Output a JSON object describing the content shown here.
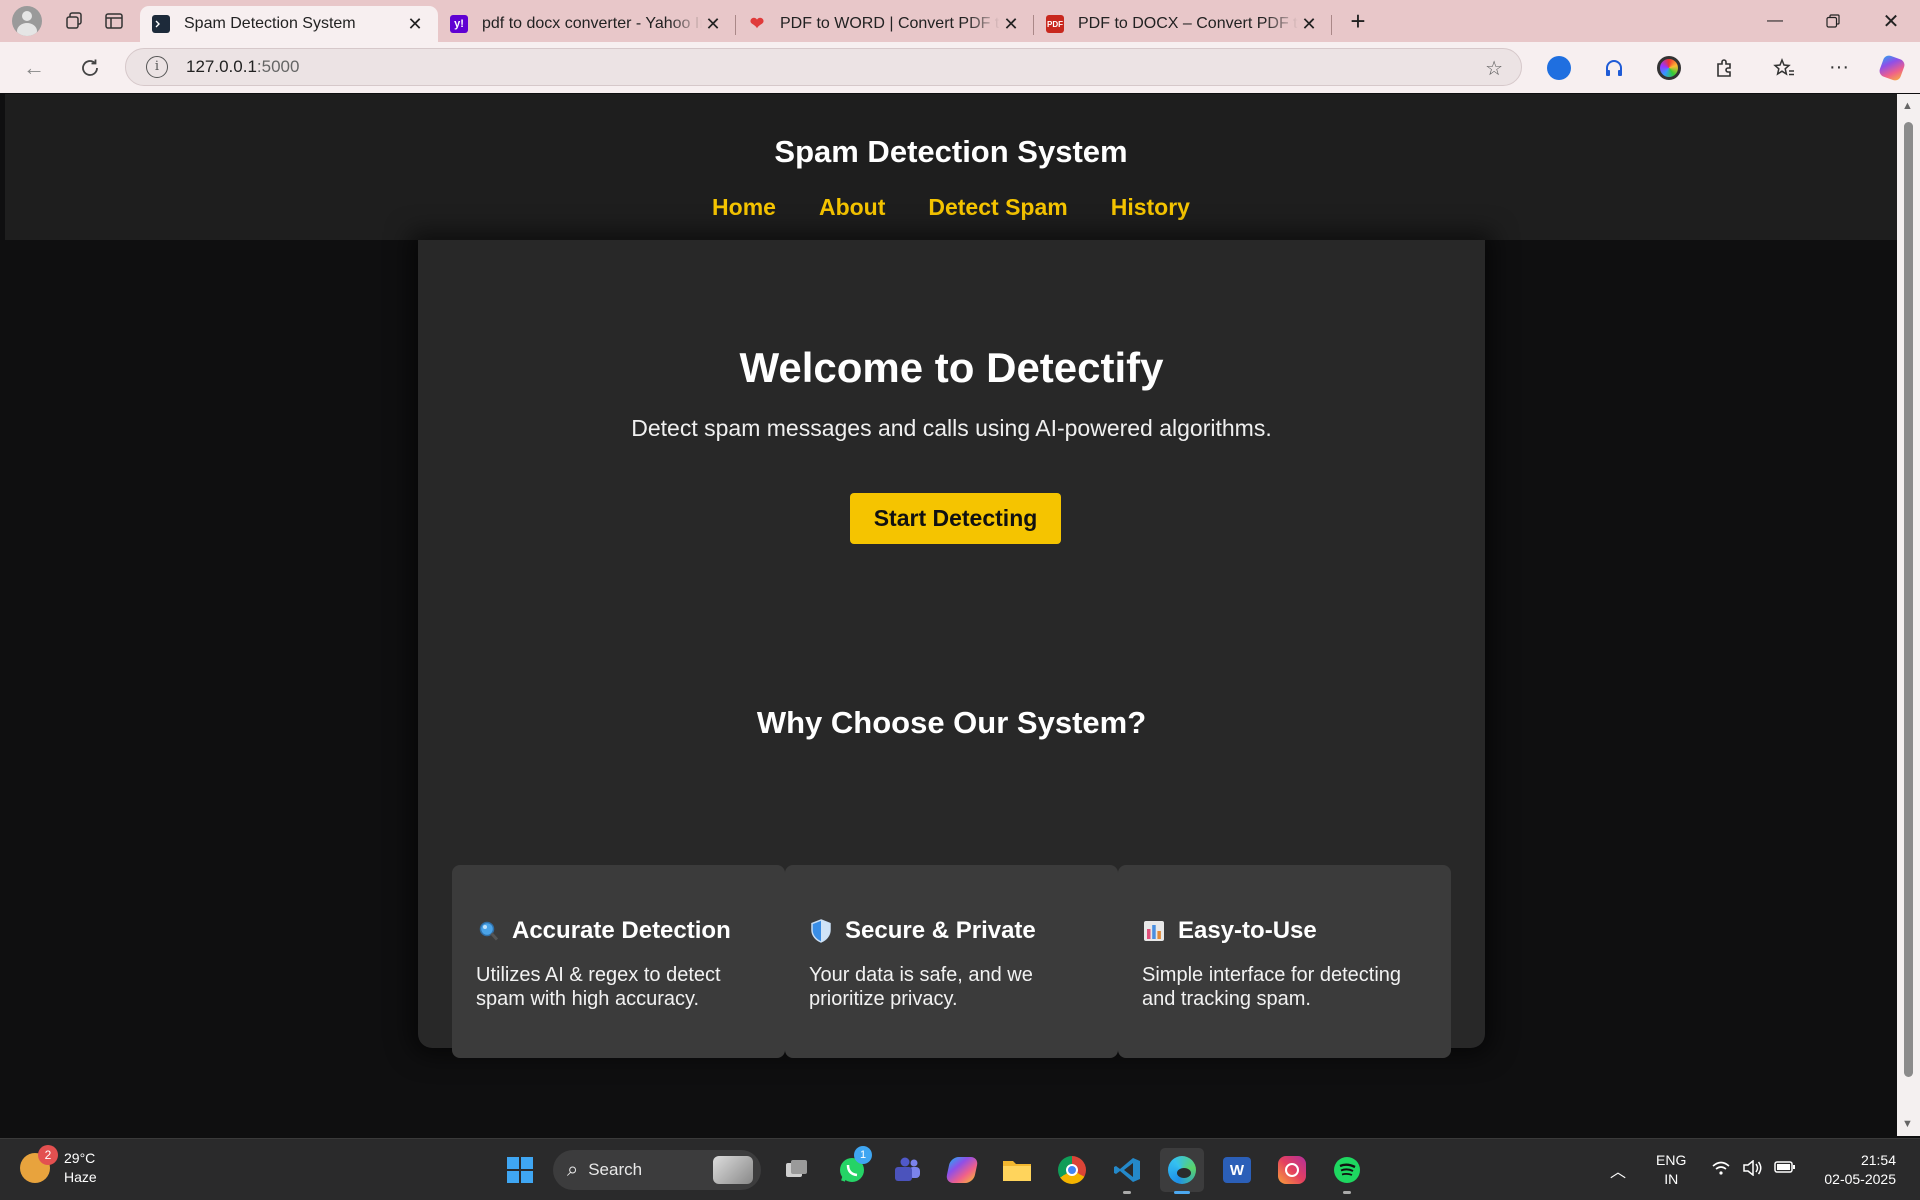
{
  "browser": {
    "tabs": [
      {
        "title": "Spam Detection System",
        "favicon": "terminal-icon",
        "active": true
      },
      {
        "title": "pdf to docx converter - Yahoo India",
        "favicon": "yahoo-icon",
        "active": false
      },
      {
        "title": "PDF to WORD | Convert PDF to Word",
        "favicon": "heart-icon",
        "active": false
      },
      {
        "title": "PDF to DOCX – Convert PDF to DOCX",
        "favicon": "pdf-icon",
        "active": false
      }
    ],
    "url_host": "127.0.0.1",
    "url_port": ":5000",
    "pdf_favicon_text": "PDF",
    "yahoo_favicon_text": "y!"
  },
  "site": {
    "title": "Spam Detection System",
    "nav": [
      "Home",
      "About",
      "Detect Spam",
      "History"
    ],
    "accent_color": "#f5c400"
  },
  "hero": {
    "title": "Welcome to Detectify",
    "subtitle": "Detect spam messages and calls using AI-powered algorithms.",
    "cta_label": "Start Detecting"
  },
  "features": {
    "title": "Why Choose Our System?",
    "cards": [
      {
        "icon": "magnifier-icon",
        "title": "Accurate Detection",
        "body": "Utilizes AI & regex to detect spam with high accuracy."
      },
      {
        "icon": "shield-icon",
        "title": "Secure & Private",
        "body": "Your data is safe, and we prioritize privacy."
      },
      {
        "icon": "bar-chart-icon",
        "title": "Easy-to-Use",
        "body": "Simple interface for detecting and tracking spam."
      }
    ]
  },
  "taskbar": {
    "weather_badge": "2",
    "temperature": "29°C",
    "condition": "Haze",
    "search_label": "Search",
    "whatsapp_badge": "1",
    "word_letter": "W",
    "lang_top": "ENG",
    "lang_bottom": "IN",
    "time": "21:54",
    "date": "02-05-2025"
  }
}
